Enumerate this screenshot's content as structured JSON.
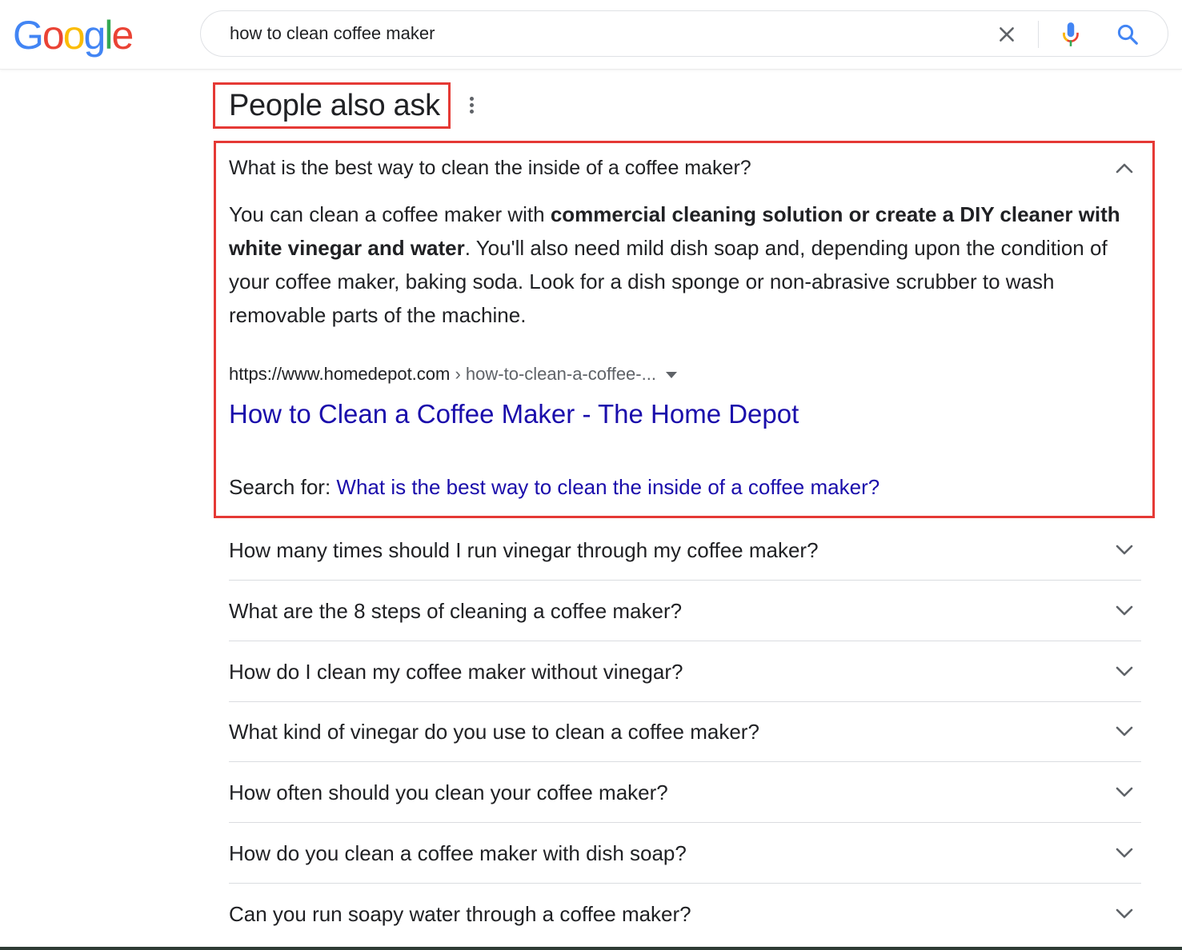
{
  "header": {
    "logo_letters": [
      {
        "char": "G",
        "color": "#4285F4"
      },
      {
        "char": "o",
        "color": "#EA4335"
      },
      {
        "char": "o",
        "color": "#FBBC05"
      },
      {
        "char": "g",
        "color": "#4285F4"
      },
      {
        "char": "l",
        "color": "#34A853"
      },
      {
        "char": "e",
        "color": "#EA4335"
      }
    ],
    "search_query": "how to clean coffee maker",
    "icons": {
      "clear": "close-icon",
      "mic": "microphone-icon",
      "search": "search-icon"
    }
  },
  "paa": {
    "title": "People also ask",
    "menu_icon": "more-vert-icon",
    "expanded": {
      "question": "What is the best way to clean the inside of a coffee maker?",
      "answer_part1": "You can clean a coffee maker with ",
      "answer_bold": "commercial cleaning solution or create a DIY cleaner with white vinegar and water",
      "answer_part2": ". You'll also need mild dish soap and, depending upon the condition of your coffee maker, baking soda. Look for a dish sponge or non-abrasive scrubber to wash removable parts of the machine.",
      "source_domain": "https://www.homedepot.com",
      "source_path": " › how-to-clean-a-coffee-...",
      "result_title": "How to Clean a Coffee Maker - The Home Depot",
      "search_for_label": "Search for: ",
      "search_for_query": "What is the best way to clean the inside of a coffee maker?"
    },
    "questions": [
      "How many times should I run vinegar through my coffee maker?",
      "What are the 8 steps of cleaning a coffee maker?",
      "How do I clean my coffee maker without vinegar?",
      "What kind of vinegar do you use to clean a coffee maker?",
      "How often should you clean your coffee maker?",
      "How do you clean a coffee maker with dish soap?",
      "Can you run soapy water through a coffee maker?"
    ]
  },
  "colors": {
    "highlight_border": "#e53935",
    "link": "#1a0dab",
    "text": "#202124",
    "secondary_text": "#5f6368"
  }
}
